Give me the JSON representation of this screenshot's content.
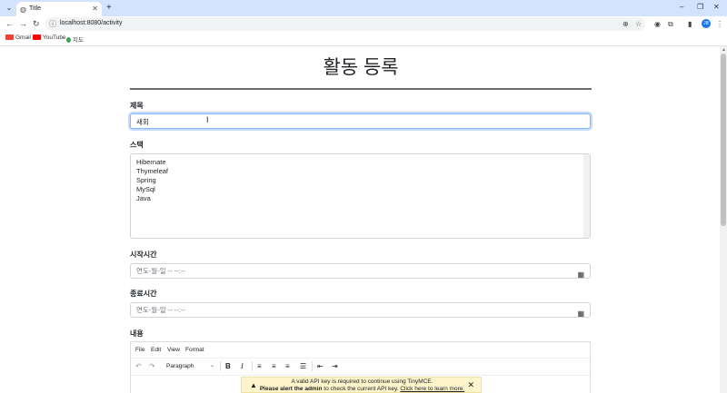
{
  "browser": {
    "tab_title": "Title",
    "url": "localhost:8080/activity",
    "profile_initial": "JB"
  },
  "bookmarks": [
    {
      "label": "Gmail",
      "color": "#ea4335"
    },
    {
      "label": "YouTube",
      "color": "#ff0000"
    },
    {
      "label": "지도",
      "color": "#34a853"
    }
  ],
  "page": {
    "title": "활동 등록",
    "fields": {
      "title_label": "제목",
      "title_value": "새회",
      "stack_label": "스택",
      "stack_lines": [
        "Hibernate",
        "Thymeleaf",
        "Spring",
        "MySql",
        "Java"
      ],
      "start_label": "시작시간",
      "start_placeholder": "연도-월-일 -- --:--",
      "end_label": "종료시간",
      "end_placeholder": "연도-월-일 -- --:--",
      "content_label": "내용"
    }
  },
  "editor": {
    "menus": [
      "File",
      "Edit",
      "View",
      "Format"
    ],
    "block_format": "Paragraph",
    "notice_line1": "A valid API key is required to continue using TinyMCE.",
    "notice_bold": "Please alert the admin",
    "notice_mid": " to check the current API key. ",
    "notice_link": "Click here to learn more."
  },
  "colors": {
    "tabstrip": "#d3e3fd",
    "focus_border": "#86b7fe",
    "notice_bg": "#fff5cc"
  }
}
